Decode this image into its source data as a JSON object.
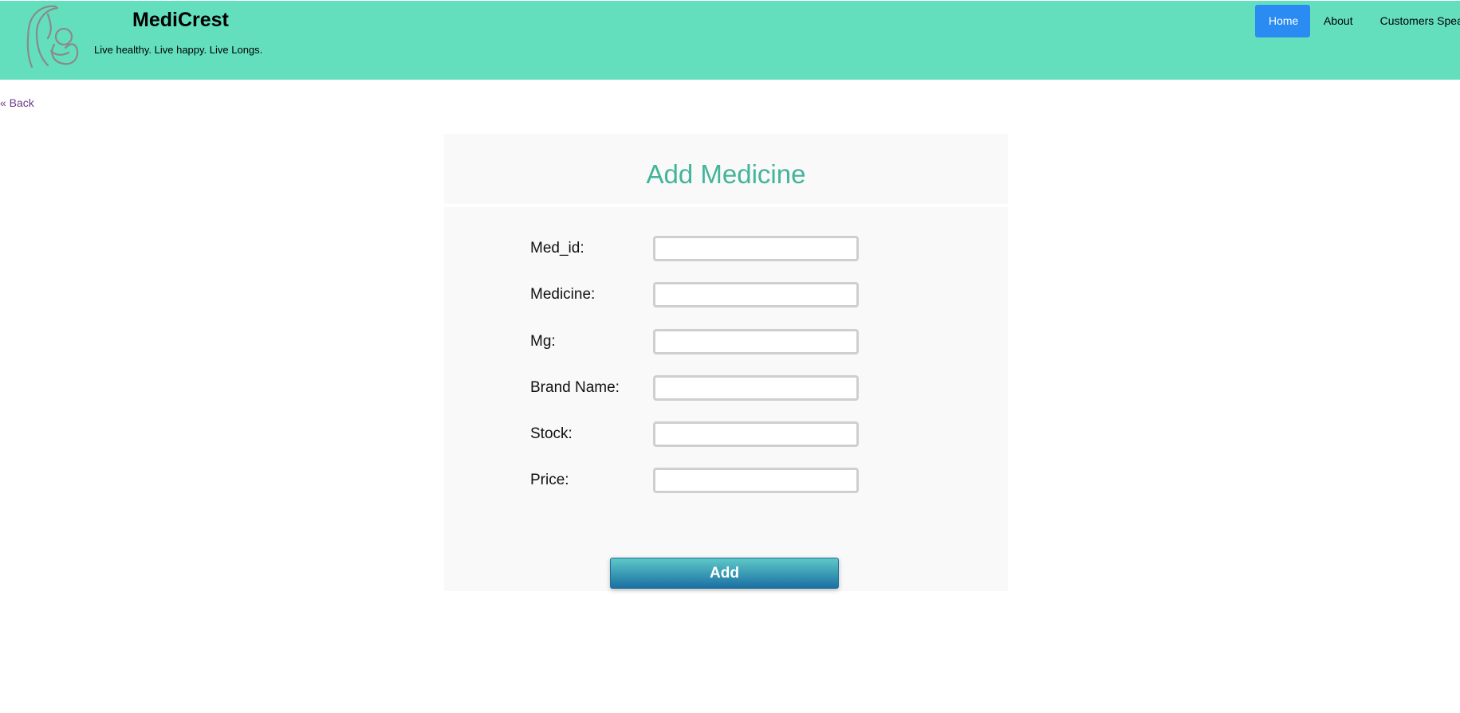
{
  "brand": {
    "name": "MediCrest",
    "tagline": "Live healthy. Live happy. Live Longs.",
    "logo_icon": "mother-and-child-logo"
  },
  "nav": {
    "items": [
      {
        "label": "Home",
        "active": true
      },
      {
        "label": "About",
        "active": false
      },
      {
        "label": "Customers Speak",
        "active": false
      }
    ]
  },
  "back_link": "« Back",
  "form": {
    "title": "Add Medicine",
    "fields": [
      {
        "label": "Med_id:",
        "value": ""
      },
      {
        "label": "Medicine:",
        "value": ""
      },
      {
        "label": "Mg:",
        "value": ""
      },
      {
        "label": "Brand Name:",
        "value": ""
      },
      {
        "label": "Stock:",
        "value": ""
      },
      {
        "label": "Price:",
        "value": ""
      }
    ],
    "submit_label": "Add"
  },
  "colors": {
    "header_bg": "#63dfbe",
    "nav_active_bg": "#2a8bf2",
    "title_color": "#43b49a",
    "card_bg": "#f9f9f9"
  }
}
